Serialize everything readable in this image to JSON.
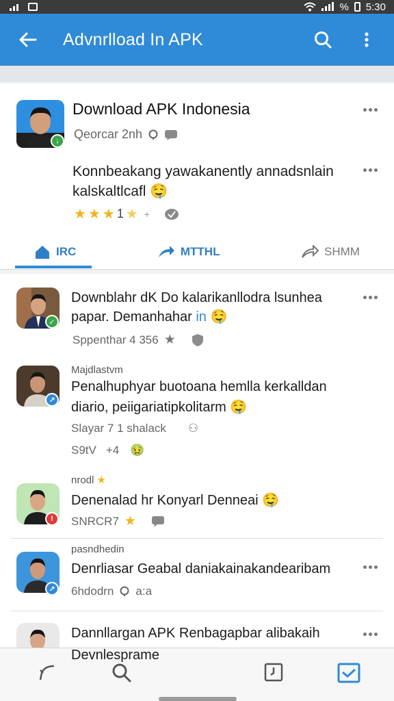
{
  "status_bar": {
    "time": "5:30",
    "battery_symbol": "%"
  },
  "app_bar": {
    "title": "Advnrlload In APK",
    "accent": "#2f8ad8"
  },
  "featured": {
    "title": "Download APK Indonesia",
    "meta": "Qeorcar 2nh",
    "body": "Konnbeakang yawakanently annadsnlain kalskaltlcafl",
    "rating_num": "1",
    "rating_extra": "+",
    "tabs": [
      {
        "label": "IRC",
        "icon": "home-icon",
        "active": true
      },
      {
        "label": "MTTHL",
        "icon": "share-arrow-icon",
        "active": false
      },
      {
        "label": "SHMM",
        "icon": "forward-icon",
        "active": false
      }
    ]
  },
  "posts": [
    {
      "line1": "Downblahr dK Do kalarikanllodra lsunhea",
      "line2": "papar. Demanhahar",
      "line2_accent": "in",
      "sub": "Sppenthar 4 356",
      "badge_color": "#3aa648"
    },
    {
      "header": "Majdlastvm",
      "line1": "Penalhuphyar buotoana hemlla kerkalldan",
      "line2": "diario, peiigariatipkolitarm",
      "sub": "Slayar 7 1 shalack",
      "sub2": "S9tV",
      "sub2_extra": "+4",
      "badge_color": "#2f8ad8"
    },
    {
      "header": "nrodl",
      "line1": "Denenalad hr Konyarl Denneai",
      "sub": "SNRCR7",
      "badge_color": "#e03a3a"
    },
    {
      "header": "pasndhedin",
      "line1": "Denrliasar Geabal daniakainakandearibam",
      "sub": "6hdodrn",
      "sub_extra": "a:a",
      "badge_color": "#2f8ad8"
    },
    {
      "line1": "Dannllargan APK Renbagapbar alibakaih",
      "line2": "Devnlesprame"
    }
  ],
  "bottom_nav": {
    "items": [
      {
        "icon": "back-icon"
      },
      {
        "icon": "search-icon"
      },
      {
        "icon": "clock-icon"
      },
      {
        "icon": "inbox-icon"
      }
    ]
  }
}
